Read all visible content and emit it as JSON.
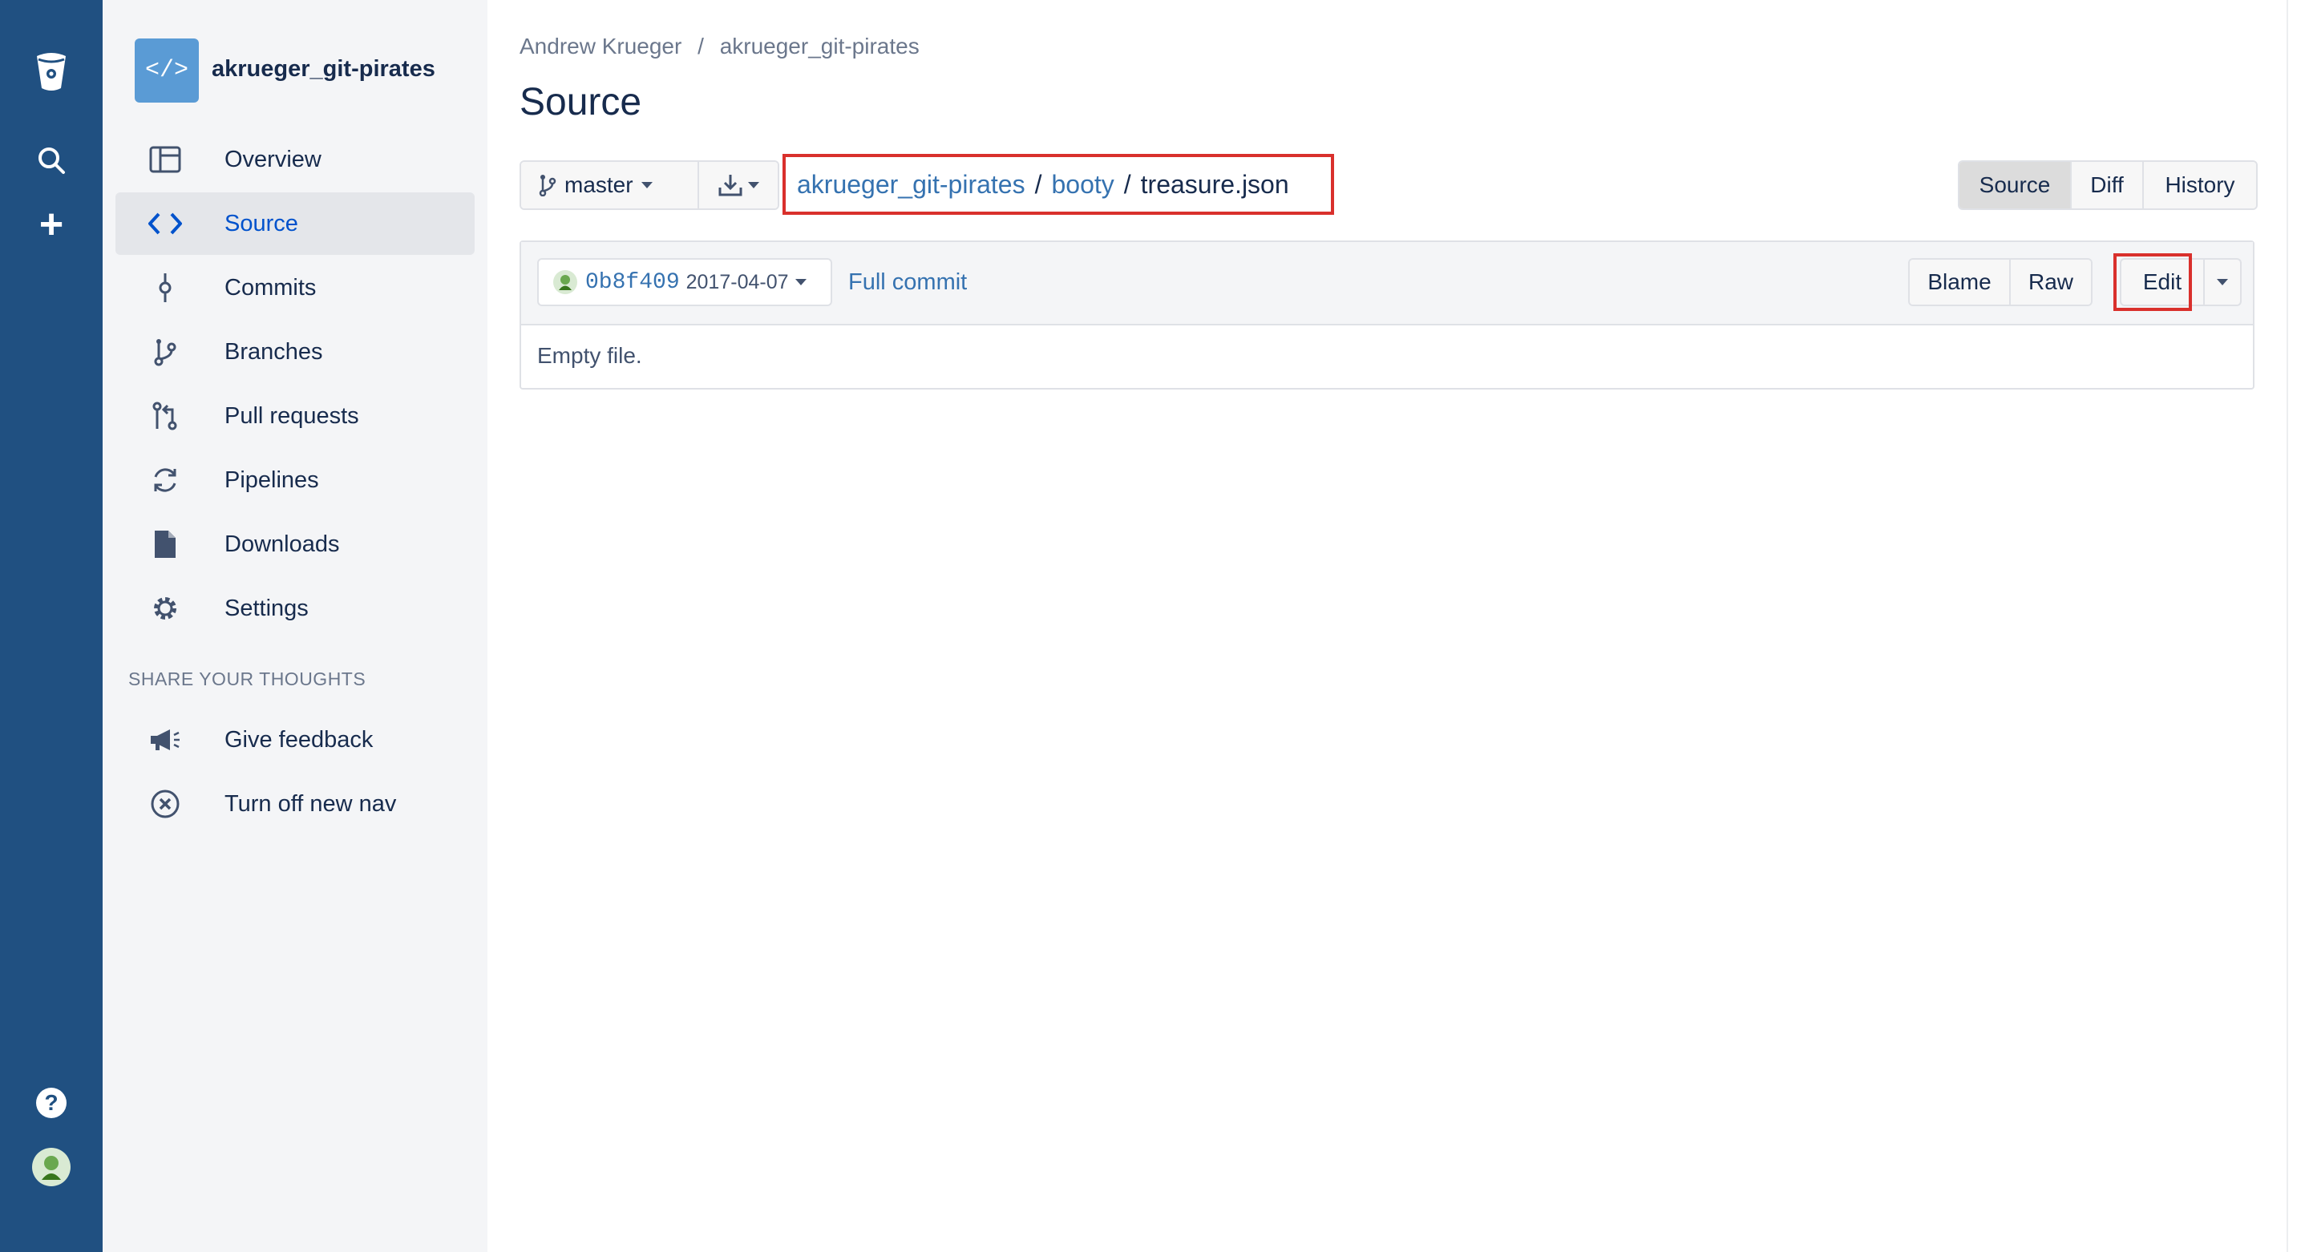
{
  "global_nav": {
    "icons": [
      "bitbucket-logo-icon",
      "search-icon",
      "create-plus-icon",
      "help-icon",
      "user-avatar-icon"
    ],
    "help_glyph": "?",
    "plus_glyph": "+"
  },
  "sidebar": {
    "repo_name": "akrueger_git-pirates",
    "repo_avatar_glyph": "</>",
    "items": [
      {
        "label": "Overview",
        "icon": "overview-icon"
      },
      {
        "label": "Source",
        "icon": "source-code-icon",
        "active": true
      },
      {
        "label": "Commits",
        "icon": "commit-icon"
      },
      {
        "label": "Branches",
        "icon": "branch-icon"
      },
      {
        "label": "Pull requests",
        "icon": "pull-request-icon"
      },
      {
        "label": "Pipelines",
        "icon": "pipelines-icon"
      },
      {
        "label": "Downloads",
        "icon": "downloads-icon"
      },
      {
        "label": "Settings",
        "icon": "gear-icon"
      }
    ],
    "section_header": "SHARE YOUR THOUGHTS",
    "feedback_items": [
      {
        "label": "Give feedback",
        "icon": "megaphone-icon"
      },
      {
        "label": "Turn off new nav",
        "icon": "close-circle-icon"
      }
    ]
  },
  "main": {
    "breadcrumb": {
      "owner": "Andrew Krueger",
      "separator": "/",
      "repo": "akrueger_git-pirates"
    },
    "title": "Source",
    "branch_label": "master",
    "file_path": {
      "segments": [
        "akrueger_git-pirates",
        "booty"
      ],
      "separator": "/",
      "current": "treasure.json"
    },
    "view_tabs": [
      "Source",
      "Diff",
      "History"
    ],
    "selected_view": "Source",
    "commit": {
      "hash": "0b8f409",
      "date": "2017-04-07"
    },
    "full_commit_label": "Full commit",
    "file_actions": {
      "blame": "Blame",
      "raw": "Raw",
      "edit": "Edit"
    },
    "file_body": "Empty file.",
    "highlight_color": "#D9302C",
    "accent_color": "#205081"
  }
}
